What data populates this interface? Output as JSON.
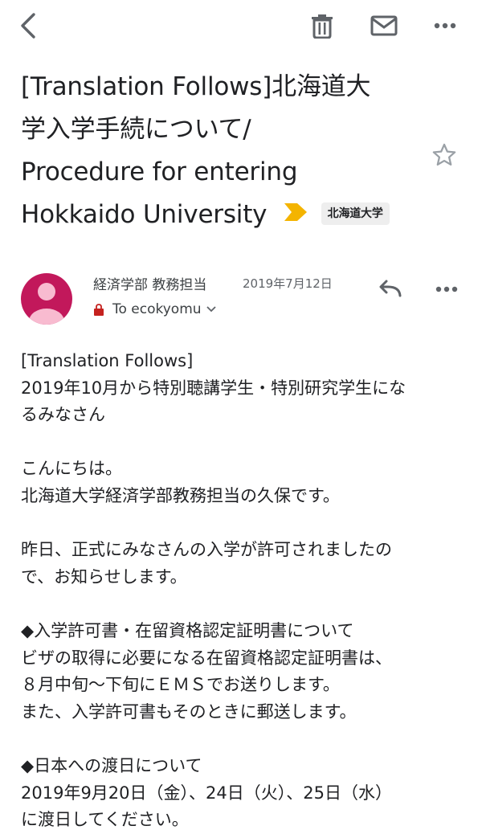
{
  "toolbar": {
    "icons": [
      "back-arrow-icon",
      "trash-icon",
      "mail-icon",
      "more-horizontal-icon"
    ]
  },
  "subject": {
    "lines": [
      "[Translation Follows]北海道大",
      "学入学手続について/",
      "Procedure for entering",
      "Hokkaido University"
    ],
    "label": "北海道大学",
    "label_color": "#f4b400"
  },
  "message": {
    "sender": "経済学部 教務担当",
    "date": "2019年7月12日",
    "recipient": "To ecokyomu",
    "avatar_color": "#c2185b"
  },
  "body_lines": [
    "[Translation Follows]",
    "2019年10月から特別聴講学生・特別研究学生にな",
    "るみなさん",
    "",
    "こんにちは。",
    "北海道大学経済学部教務担当の久保です。",
    "",
    "昨日、正式にみなさんの入学が許可されましたの",
    "で、お知らせします。",
    "",
    "◆入学許可書・在留資格認定証明書について",
    "ビザの取得に必要になる在留資格認定証明書は、",
    "８月中旬〜下旬にＥＭＳでお送りします。",
    "また、入学許可書もそのときに郵送します。",
    "",
    "◆日本への渡日について",
    "2019年9月20日（金）、24日（火）、25日（水）",
    "に渡日してください。"
  ]
}
